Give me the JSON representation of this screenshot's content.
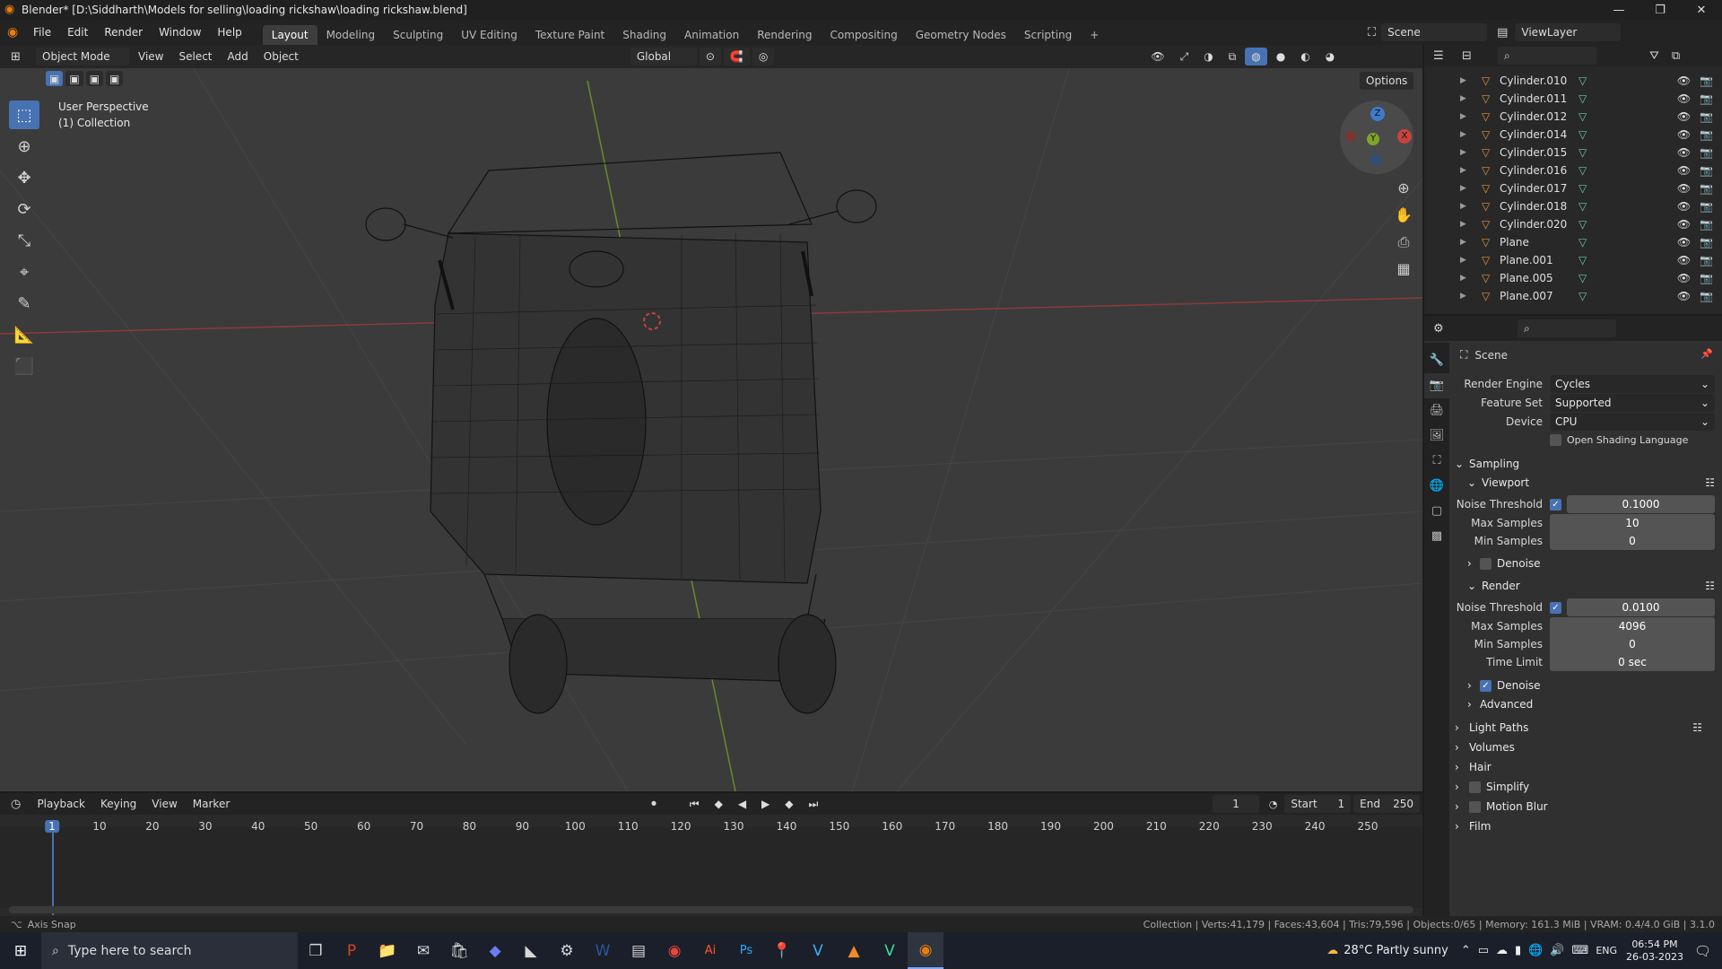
{
  "window": {
    "title": "Blender* [D:\\Siddharth\\Models for selling\\loading rickshaw\\loading rickshaw.blend]"
  },
  "menus": [
    "File",
    "Edit",
    "Render",
    "Window",
    "Help"
  ],
  "workspaces": [
    "Layout",
    "Modeling",
    "Sculpting",
    "UV Editing",
    "Texture Paint",
    "Shading",
    "Animation",
    "Rendering",
    "Compositing",
    "Geometry Nodes",
    "Scripting"
  ],
  "scene": {
    "label": "Scene",
    "view_layer": "ViewLayer"
  },
  "viewport": {
    "mode": "Object Mode",
    "menus": [
      "View",
      "Select",
      "Add",
      "Object"
    ],
    "orientation": "Global",
    "options": "Options",
    "overlay_title": "User Perspective",
    "overlay_collection": "(1) Collection",
    "gizmo": {
      "x": "X",
      "y": "Y",
      "z": "Z"
    }
  },
  "outliner": {
    "items": [
      "Cylinder.010",
      "Cylinder.011",
      "Cylinder.012",
      "Cylinder.014",
      "Cylinder.015",
      "Cylinder.016",
      "Cylinder.017",
      "Cylinder.018",
      "Cylinder.020",
      "Plane",
      "Plane.001",
      "Plane.005",
      "Plane.007"
    ]
  },
  "properties": {
    "context": "Scene",
    "render_engine_label": "Render Engine",
    "render_engine": "Cycles",
    "feature_set_label": "Feature Set",
    "feature_set": "Supported",
    "device_label": "Device",
    "device": "CPU",
    "osl": "Open Shading Language",
    "sampling": "Sampling",
    "viewport_sub": "Viewport",
    "noise_threshold_label": "Noise Threshold",
    "vp_noise_threshold": "0.1000",
    "max_samples_label": "Max Samples",
    "vp_max_samples": "10",
    "min_samples_label": "Min Samples",
    "vp_min_samples": "0",
    "denoise": "Denoise",
    "render_sub": "Render",
    "r_noise_threshold": "0.0100",
    "r_max_samples": "4096",
    "r_min_samples": "0",
    "time_limit_label": "Time Limit",
    "r_time_limit": "0 sec",
    "advanced": "Advanced",
    "panels": [
      "Light Paths",
      "Volumes",
      "Hair",
      "Simplify",
      "Motion Blur",
      "Film"
    ]
  },
  "timeline": {
    "menus": [
      "Playback",
      "Keying",
      "View",
      "Marker"
    ],
    "current_frame": "1",
    "start_label": "Start",
    "start": "1",
    "end_label": "End",
    "end": "250",
    "ticks": [
      "1",
      "10",
      "20",
      "30",
      "40",
      "50",
      "60",
      "70",
      "80",
      "90",
      "100",
      "110",
      "120",
      "130",
      "140",
      "150",
      "160",
      "170",
      "180",
      "190",
      "200",
      "210",
      "220",
      "230",
      "240",
      "250"
    ]
  },
  "status": {
    "left": "Axis Snap",
    "right": "Collection | Verts:41,179 | Faces:43,604 | Tris:79,596 | Objects:0/65 | Memory: 161.3 MiB | VRAM: 0.4/4.0 GiB | 3.1.0"
  },
  "taskbar": {
    "search_placeholder": "Type here to search",
    "weather": "28°C  Partly sunny",
    "lang": "ENG",
    "time": "06:54 PM",
    "date": "26-03-2023"
  },
  "colors": {
    "accent": "#4772b3",
    "x_axis": "#c8423e",
    "y_axis": "#7fa32b",
    "z_axis": "#3d7ccd"
  }
}
